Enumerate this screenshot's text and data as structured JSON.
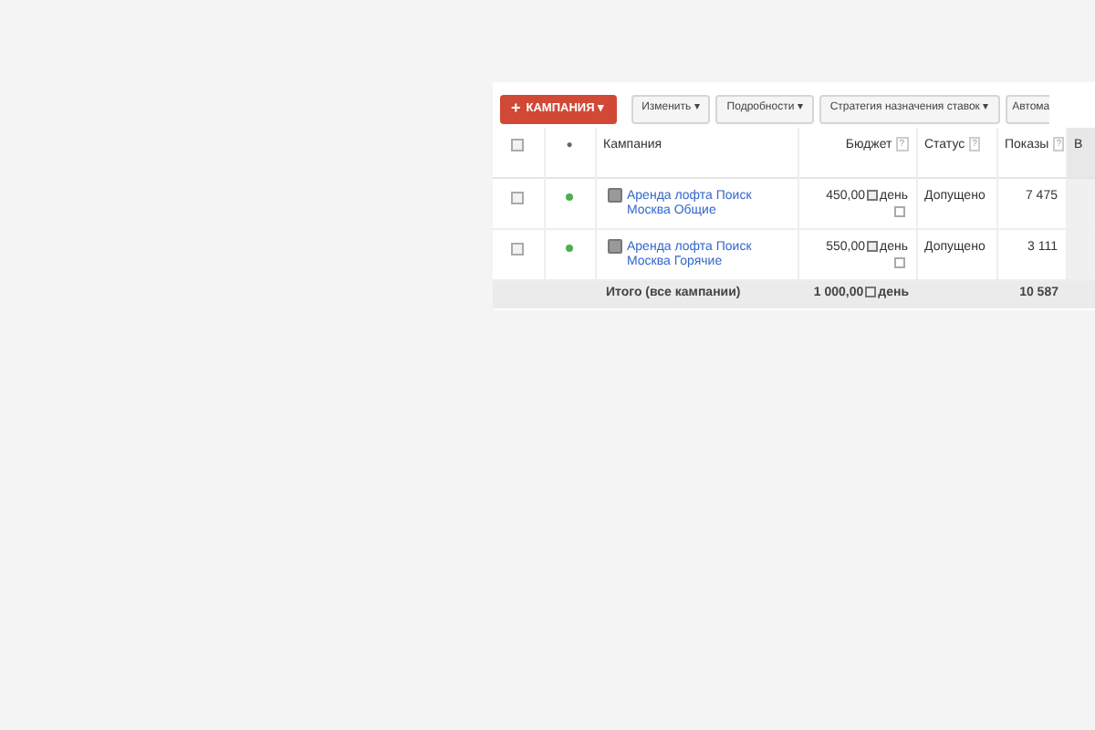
{
  "toolbar": {
    "primary": {
      "icon": "+",
      "label": "КАМПАНИЯ",
      "caret": "▾"
    },
    "buttons": [
      {
        "label": "Изменить",
        "caret": "▾"
      },
      {
        "label": "Подробности",
        "caret": "▾"
      },
      {
        "label": "Стратегия назначения ставок",
        "caret": "▾"
      },
      {
        "label": "Автома"
      }
    ]
  },
  "table": {
    "columns": [
      {
        "kind": "checkbox",
        "checked": false
      },
      {
        "kind": "dot",
        "label": "●"
      },
      {
        "kind": "text",
        "label": "Кампания"
      },
      {
        "kind": "num",
        "label": "Бюджет",
        "help": "?"
      },
      {
        "kind": "text",
        "label": "Статус",
        "help": "?"
      },
      {
        "kind": "num",
        "label": "Показы",
        "help": "?"
      },
      {
        "kind": "cut",
        "label": "В"
      }
    ],
    "rows": [
      {
        "checked": false,
        "color": "#4caf50",
        "campaign": "Аренда лофта Поиск Москва Общие",
        "budget": "450,00",
        "period": "день",
        "status": "Допущено",
        "impressions": "7 475"
      },
      {
        "checked": false,
        "color": "#4caf50",
        "campaign": "Аренда лофта Поиск Москва Горячие",
        "budget": "550,00",
        "period": "день",
        "status": "Допущено",
        "impressions": "3 111"
      }
    ],
    "total": {
      "label": "Итого (все кампании)",
      "budget": "1 000,00",
      "period": "день",
      "impressions": "10 587"
    }
  }
}
